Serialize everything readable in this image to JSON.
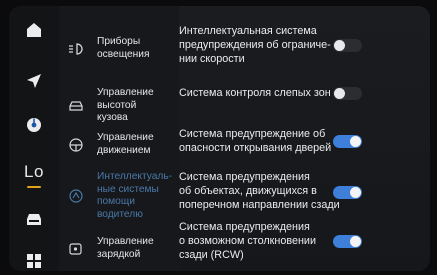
{
  "nav": [
    {
      "icon": "home-icon"
    },
    {
      "icon": "navigation-arrow-icon"
    },
    {
      "icon": "music-disc-icon"
    },
    {
      "icon": "lo-brand-icon",
      "label": "Lo",
      "accent": "#e0a21c"
    },
    {
      "icon": "car-icon"
    },
    {
      "icon": "apps-grid-icon"
    }
  ],
  "menu": {
    "items": [
      {
        "label": [
          "Приборы",
          "освещения"
        ],
        "icon": "headlights-icon",
        "active": false
      },
      {
        "label": [
          "Управление",
          "высотой",
          "кузова"
        ],
        "icon": "car-body-icon",
        "active": false
      },
      {
        "label": [
          "Управление",
          "движением"
        ],
        "icon": "steering-wheel-icon",
        "active": false
      },
      {
        "label": [
          "Интеллектуаль-",
          "ные системы",
          "помощи",
          "водителю"
        ],
        "icon": "driver-assist-icon",
        "active": true
      },
      {
        "label": [
          "Управление",
          "зарядкой"
        ],
        "icon": "charging-icon",
        "active": false
      }
    ],
    "active_color": "#4a78a8"
  },
  "settings": [
    {
      "label": [
        "Интеллектуальная система",
        "предупреждения об ограниче-",
        "нии скорости"
      ],
      "enabled": false
    },
    {
      "label": [
        "Система контроля слепых зон"
      ],
      "enabled": false
    },
    {
      "label": [
        "Система предупреждение об",
        "опасности открывания дверей"
      ],
      "enabled": true
    },
    {
      "label": [
        "Система предупреждения",
        "об объектах, движущихся в",
        "поперечном направлении сзади"
      ],
      "enabled": true
    },
    {
      "label": [
        "Система предупреждения",
        "о возможном столкновении",
        "сзади (RCW)"
      ],
      "enabled": true
    }
  ],
  "colors": {
    "toggle_on": "#3d7fd9",
    "toggle_off": "#2b2d31"
  }
}
